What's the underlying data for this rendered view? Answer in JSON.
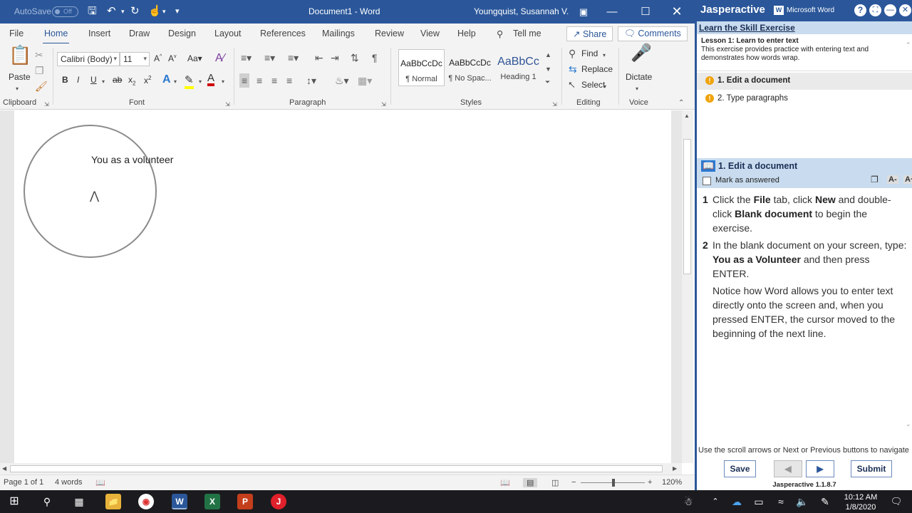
{
  "word": {
    "autosave_label": "AutoSave",
    "autosave_state": "Off",
    "doc_title": "Document1  -  Word",
    "user": "Youngquist, Susannah V.",
    "tabs": [
      "File",
      "Home",
      "Insert",
      "Draw",
      "Design",
      "Layout",
      "References",
      "Mailings",
      "Review",
      "View",
      "Help"
    ],
    "tell_me": "Tell me",
    "share": "Share",
    "comments": "Comments",
    "ribbon": {
      "paste": "Paste",
      "clipboard": "Clipboard",
      "font_name": "Calibri (Body)",
      "font_size": "11",
      "font_group": "Font",
      "paragraph_group": "Paragraph",
      "styles": [
        {
          "preview": "AaBbCcDc",
          "name": "¶ Normal"
        },
        {
          "preview": "AaBbCcDc",
          "name": "¶ No Spac..."
        },
        {
          "preview": "AaBbCc",
          "name": "Heading 1"
        }
      ],
      "styles_group": "Styles",
      "find": "Find",
      "replace": "Replace",
      "select": "Select",
      "editing_group": "Editing",
      "dictate": "Dictate",
      "voice_group": "Voice"
    },
    "document_text": "You as a volunteer",
    "status": {
      "page": "Page 1 of 1",
      "words": "4 words",
      "zoom": "120%"
    }
  },
  "jasper": {
    "brand": "Jasperactive",
    "app": "Microsoft Word",
    "lesson_header": "Learn the Skill Exercise",
    "lesson_title": "Lesson 1: Learn to enter text",
    "lesson_desc": "This exercise provides practice with entering text and demonstrates how words wrap.",
    "tasks": [
      "1. Edit a document",
      "2. Type paragraphs"
    ],
    "step_title": "1. Edit a document",
    "mark_answered": "Mark as answered",
    "font_smaller": "A-",
    "font_larger": "A+",
    "steps": [
      {
        "num": "1",
        "parts": [
          {
            "t": "Click the ",
            "b": false
          },
          {
            "t": "File",
            "b": true
          },
          {
            "t": " tab, click ",
            "b": false
          },
          {
            "t": "New",
            "b": true
          },
          {
            "t": " and double-click ",
            "b": false
          },
          {
            "t": "Blank document",
            "b": true
          },
          {
            "t": " to begin the exercise.",
            "b": false
          }
        ]
      },
      {
        "num": "2",
        "parts": [
          {
            "t": "In the blank document on your screen, type: ",
            "b": false
          },
          {
            "t": "You as a Volunteer",
            "b": true
          },
          {
            "t": " and then press ENTER.",
            "b": false
          }
        ]
      },
      {
        "num": "",
        "parts": [
          {
            "t": "Notice how Word allows you to enter text directly onto the screen and, when you pressed ENTER, the cursor moved to the beginning of the next line.",
            "b": false
          }
        ]
      }
    ],
    "nav_hint": "Use the scroll arrows or Next or Previous buttons to navigate",
    "save": "Save",
    "submit": "Submit",
    "version": "Jasperactive 1.1.8.7"
  },
  "taskbar": {
    "time": "10:12 AM",
    "date": "1/8/2020"
  }
}
